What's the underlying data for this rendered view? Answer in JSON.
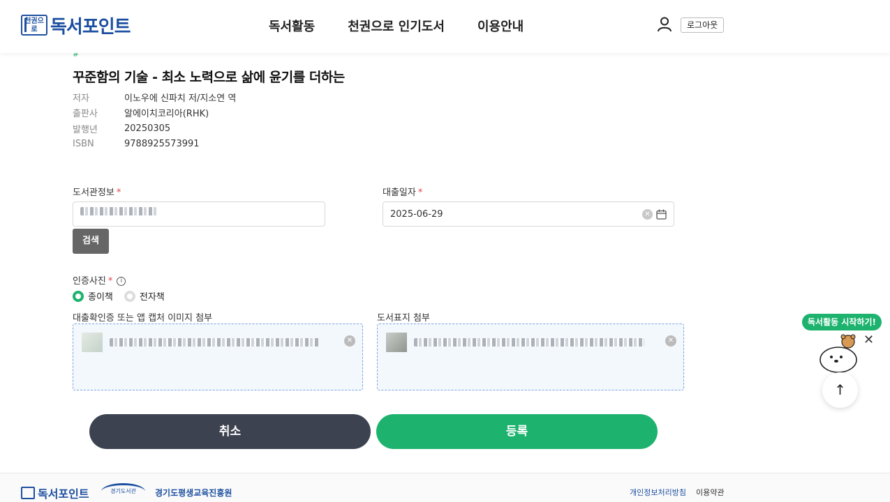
{
  "header": {
    "logo_mark": "천권으로",
    "logo_text": "독서포인트",
    "nav": [
      "독서활동",
      "천권으로 인기도서",
      "이용안내"
    ],
    "logout_label": "로그아웃"
  },
  "book": {
    "hash": "#",
    "title": "꾸준함의 기술 - 최소 노력으로 삶에 윤기를 더하는",
    "meta": [
      {
        "k": "저자",
        "v": "이노우에 신파치 저/지소연 역"
      },
      {
        "k": "출판사",
        "v": "알에이치코리아(RHK)"
      },
      {
        "k": "발행년",
        "v": "20250305"
      },
      {
        "k": "ISBN",
        "v": "9788925573991"
      }
    ]
  },
  "form": {
    "library_label": "도서관정보",
    "required_mark": "*",
    "search_label": "검색",
    "loan_date_label": "대출일자",
    "loan_date_value": "2025-06-29",
    "photo_label": "인증사진",
    "radio_paper": "종이책",
    "radio_ebook": "전자책",
    "upload_loan_label": "대출확인증 또는 앱 캡처 이미지 첨부",
    "upload_cover_label": "도서표지 첨부"
  },
  "buttons": {
    "cancel": "취소",
    "submit": "등록"
  },
  "floating": {
    "promo": "독서활동 시작하기!"
  },
  "footer": {
    "logo_text": "독서포인트",
    "library_logo": "경기도서관",
    "institute": "경기도평생교육진흥원",
    "privacy": "개인정보처리방침",
    "terms": "이용약관"
  },
  "colors": {
    "accent": "#1db36e",
    "brand": "#1d4fa0",
    "cancel_bg": "#3d4250"
  }
}
